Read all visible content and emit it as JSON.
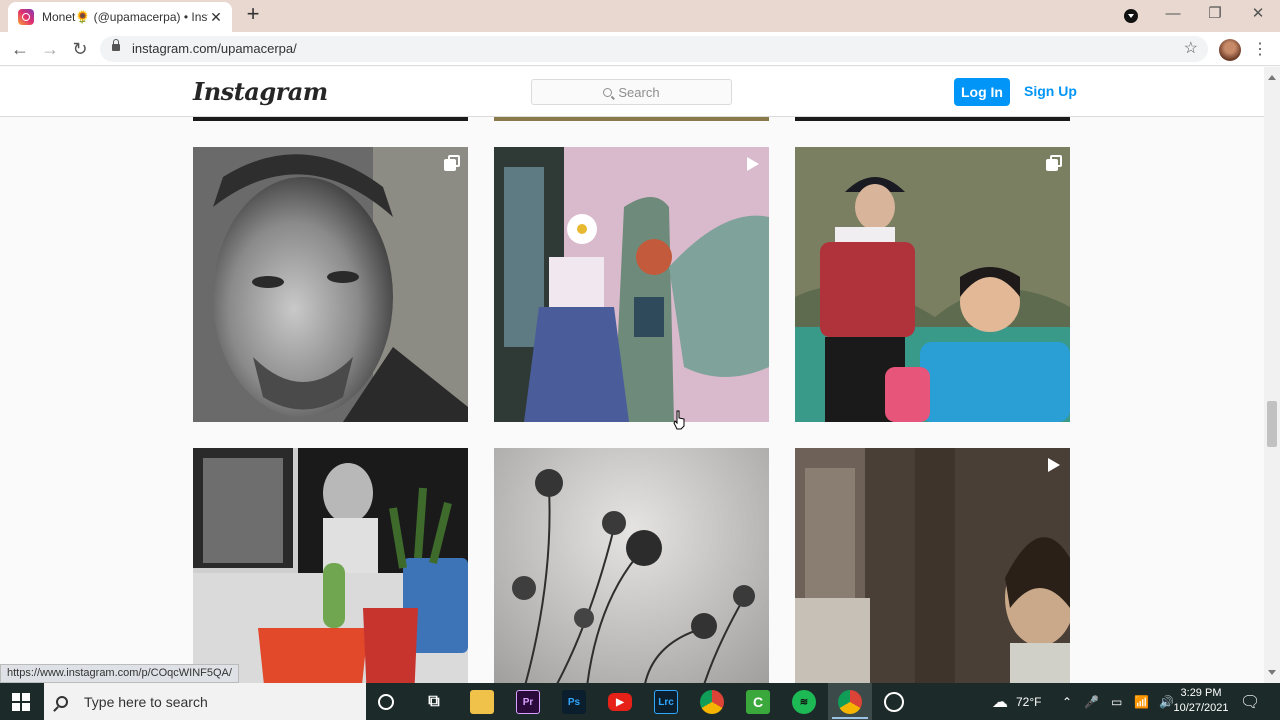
{
  "browser": {
    "tab_title": "Monet🌻 (@upamacerpa) • Insta",
    "url": "instagram.com/upamacerpa/",
    "status_url": "https://www.instagram.com/p/COqcWINF5QA/"
  },
  "instagram": {
    "logo": "Instagram",
    "search_placeholder": "Search",
    "login_label": "Log In",
    "signup_label": "Sign Up"
  },
  "posts": [
    {
      "description": "black and white portrait of a man with goatee",
      "badge": "multi"
    },
    {
      "description": "woman in patterned skirt in front of mural",
      "badge": "video"
    },
    {
      "description": "two women wearing life jackets by mountains",
      "badge": "multi"
    },
    {
      "description": "cactus and plant pots in front of old photographs",
      "badge": "none"
    },
    {
      "description": "monochrome silhouette of cosmos flowers",
      "badge": "none"
    },
    {
      "description": "dim film still of a young girl near a window",
      "badge": "video"
    }
  ],
  "taskbar": {
    "search_placeholder": "Type here to search",
    "weather": "72°F",
    "time": "3:29 PM",
    "date": "10/27/2021",
    "apps": [
      "file-explorer",
      "premiere-pro",
      "photoshop",
      "youtube",
      "lightroom-classic",
      "chrome",
      "camtasia",
      "spotify",
      "chrome-active",
      "obs"
    ]
  }
}
